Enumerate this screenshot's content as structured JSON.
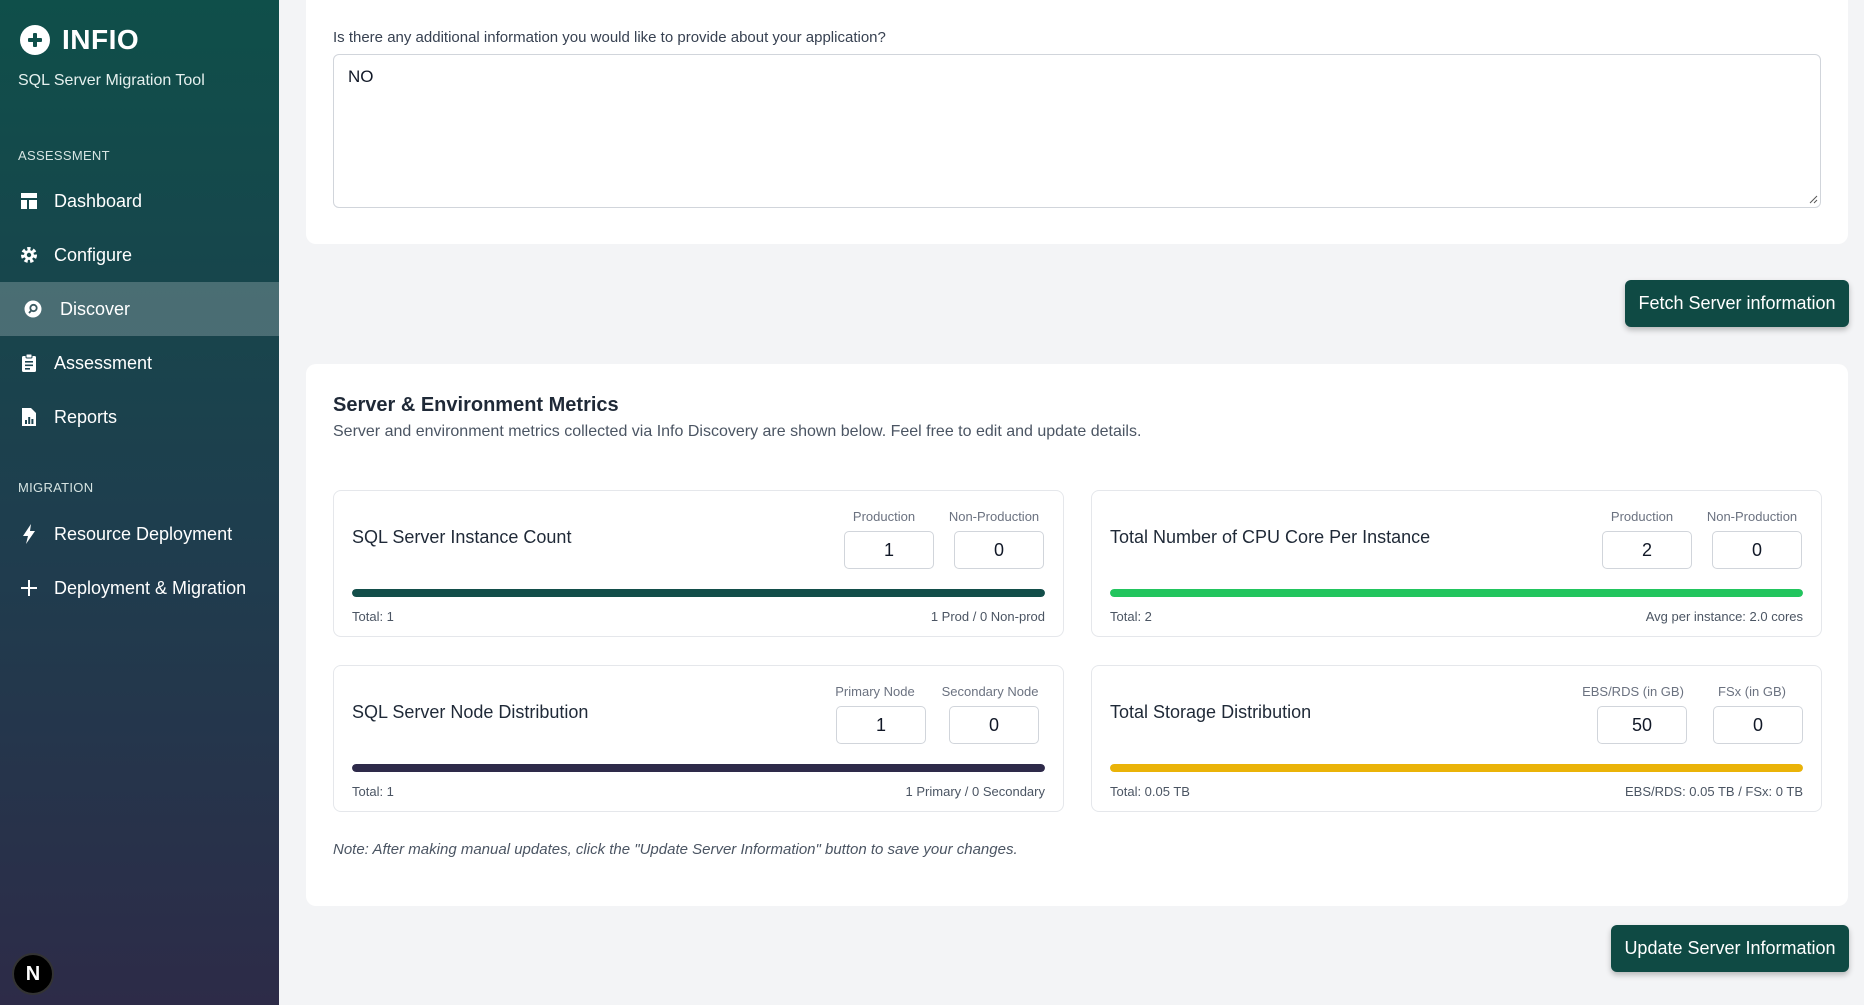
{
  "app": {
    "name": "INFIO",
    "subtitle": "SQL Server Migration Tool"
  },
  "sidebar": {
    "sections": [
      {
        "label": "ASSESSMENT"
      },
      {
        "label": "MIGRATION"
      }
    ],
    "items": [
      {
        "label": "Dashboard",
        "icon": "dashboard-icon"
      },
      {
        "label": "Configure",
        "icon": "gear-icon"
      },
      {
        "label": "Discover",
        "icon": "discover-icon",
        "active": true
      },
      {
        "label": "Assessment",
        "icon": "clipboard-icon"
      },
      {
        "label": "Reports",
        "icon": "report-icon"
      },
      {
        "label": "Resource Deployment",
        "icon": "lightning-icon"
      },
      {
        "label": "Deployment & Migration",
        "icon": "plus-icon"
      }
    ],
    "badge": "N"
  },
  "additional_info": {
    "question": "Is there any additional information you would like to provide about your application?",
    "value": "NO"
  },
  "buttons": {
    "fetch": "Fetch Server information",
    "update": "Update Server Information"
  },
  "metrics": {
    "title": "Server & Environment Metrics",
    "description": "Server and environment metrics collected via Info Discovery are shown below. Feel free to edit and update details.",
    "cards": [
      {
        "title": "SQL Server Instance Count",
        "label_a": "Production",
        "value_a": "1",
        "label_b": "Non-Production",
        "value_b": "0",
        "footer_left": "Total: 1",
        "footer_right": "1 Prod / 0 Non-prod",
        "bar_color": "#134e4a",
        "bar_fill": 1.0
      },
      {
        "title": "Total Number of CPU Core Per Instance",
        "label_a": "Production",
        "value_a": "2",
        "label_b": "Non-Production",
        "value_b": "0",
        "footer_left": "Total: 2",
        "footer_right": "Avg per instance: 2.0 cores",
        "bar_color": "#22c55e",
        "bar_fill": 1.0
      },
      {
        "title": "SQL Server Node Distribution",
        "label_a": "Primary Node",
        "value_a": "1",
        "label_b": "Secondary Node",
        "value_b": "0",
        "footer_left": "Total: 1",
        "footer_right": "1 Primary / 0 Secondary",
        "bar_color": "#2e2a4a",
        "bar_fill": 1.0
      },
      {
        "title": "Total Storage Distribution",
        "label_a": "EBS/RDS (in GB)",
        "value_a": "50",
        "label_b": "FSx (in GB)",
        "value_b": "0",
        "footer_left": "Total: 0.05 TB",
        "footer_right": "EBS/RDS: 0.05 TB / FSx: 0 TB",
        "bar_color": "#eab308",
        "bar_fill": 1.0
      }
    ],
    "note": "Note: After making manual updates, click the \"Update Server Information\" button to save your changes."
  }
}
